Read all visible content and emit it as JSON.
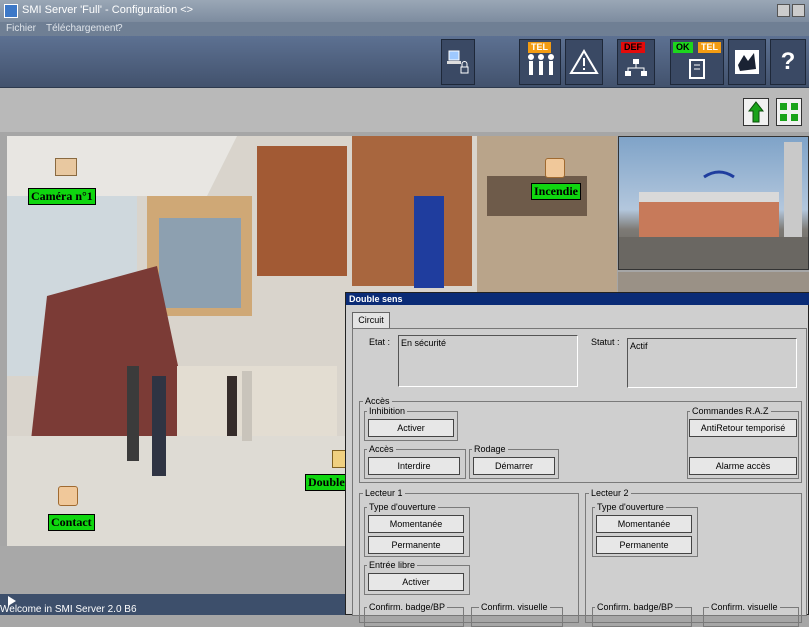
{
  "window": {
    "title": "SMI Server 'Full' - Configuration <>"
  },
  "menu": [
    "Fichier",
    "Téléchargement",
    "?"
  ],
  "toolbar": {
    "tel_tag": "TEL",
    "def_tag": "DEF",
    "ok_tag": "OK",
    "tel2_tag": "TEL",
    "help_label": "?"
  },
  "scene": {
    "labels": {
      "camera": "Caméra n°1",
      "incendie": "Incendie",
      "double": "Double",
      "contact": "Contact"
    }
  },
  "status": {
    "welcome": "Welcome in SMI Server 2.0 B6"
  },
  "dialog": {
    "title": "Double sens",
    "tab": "Circuit",
    "etat_label": "Etat :",
    "etat_value": "En sécurité",
    "statut_label": "Statut :",
    "statut_value": "Actif",
    "acces": {
      "title": "Accès",
      "inhibition_title": "Inhibition",
      "inhibition_button": "Activer",
      "acces_title": "Accès",
      "acces_button": "Interdire",
      "rodage_title": "Rodage",
      "rodage_button": "Démarrer",
      "raz_title": "Commandes R.A.Z",
      "raz_button1": "AntiRetour temporisé",
      "raz_button2": "Alarme accès"
    },
    "lecteur1": {
      "title": "Lecteur 1",
      "type_title": "Type d'ouverture",
      "btn_momentanee": "Momentanée",
      "btn_permanente": "Permanente",
      "entree_title": "Entrée libre",
      "entree_button": "Activer",
      "confirm_badge": "Confirm. badge/BP",
      "confirm_visuelle": "Confirm. visuelle"
    },
    "lecteur2": {
      "title": "Lecteur 2",
      "type_title": "Type d'ouverture",
      "btn_momentanee": "Momentanée",
      "btn_permanente": "Permanente",
      "confirm_badge": "Confirm. badge/BP",
      "confirm_visuelle": "Confirm. visuelle"
    }
  },
  "colors": {
    "label_green": "#0fd60f",
    "dialog_title": "#0a2b76",
    "toolbar": "#4c5e7d"
  }
}
